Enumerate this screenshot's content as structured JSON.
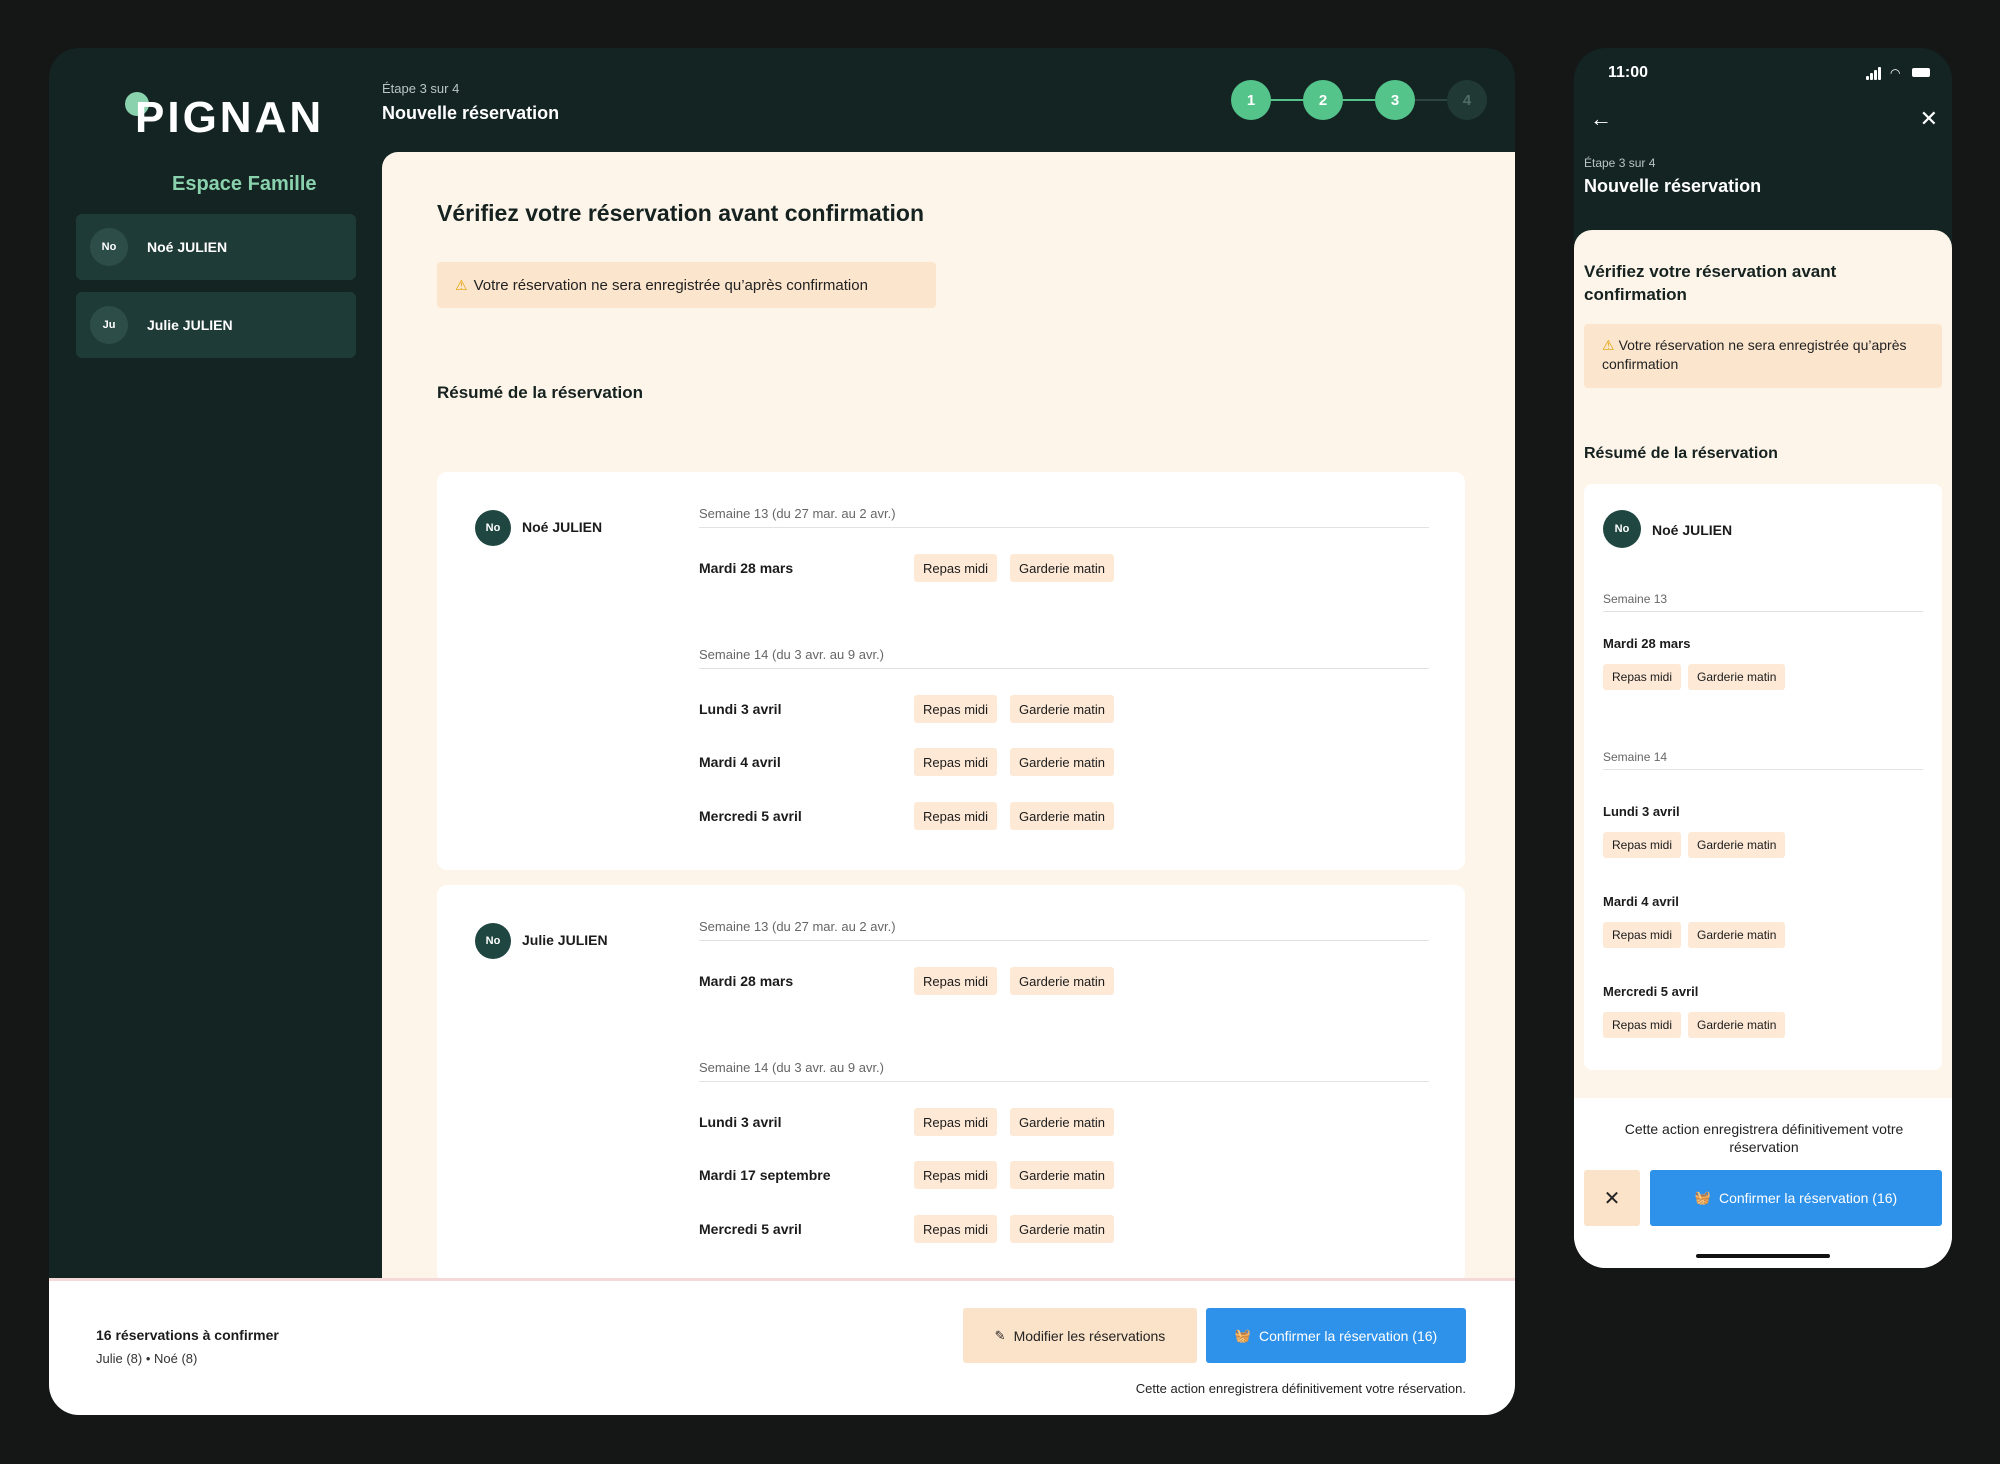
{
  "brand": {
    "name": "PIGNAN",
    "subtitle": "Espace Famille"
  },
  "sidebar": {
    "children": [
      {
        "initials": "No",
        "name": "Noé JULIEN"
      },
      {
        "initials": "Ju",
        "name": "Julie JULIEN"
      }
    ]
  },
  "header": {
    "step_text": "Étape 3 sur 4",
    "title": "Nouvelle réservation"
  },
  "stepper": {
    "steps": [
      "1",
      "2",
      "3",
      "4"
    ],
    "current": 3
  },
  "main": {
    "heading": "Vérifiez votre réservation avant confirmation",
    "warning_icon": "⚠",
    "warning": "Votre réservation ne sera enregistrée qu’après confirmation",
    "summary_title": "Résumé de la réservation",
    "cards": [
      {
        "initials": "No",
        "name": "Noé JULIEN",
        "weeks": [
          {
            "label": "Semaine 13 (du 27 mar. au 2 avr.)",
            "days": [
              {
                "date": "Mardi 28 mars",
                "tags": [
                  "Repas midi",
                  "Garderie matin"
                ]
              }
            ]
          },
          {
            "label": "Semaine 14 (du 3 avr. au 9 avr.)",
            "days": [
              {
                "date": "Lundi 3 avril",
                "tags": [
                  "Repas midi",
                  "Garderie matin"
                ]
              },
              {
                "date": "Mardi 4 avril",
                "tags": [
                  "Repas midi",
                  "Garderie matin"
                ]
              },
              {
                "date": "Mercredi 5 avril",
                "tags": [
                  "Repas midi",
                  "Garderie matin"
                ]
              }
            ]
          }
        ]
      },
      {
        "initials": "No",
        "name": "Julie JULIEN",
        "weeks": [
          {
            "label": "Semaine 13 (du 27 mar. au 2 avr.)",
            "days": [
              {
                "date": "Mardi 28 mars",
                "tags": [
                  "Repas midi",
                  "Garderie matin"
                ]
              }
            ]
          },
          {
            "label": "Semaine 14 (du 3 avr. au 9 avr.)",
            "days": [
              {
                "date": "Lundi 3 avril",
                "tags": [
                  "Repas midi",
                  "Garderie matin"
                ]
              },
              {
                "date": "Mardi 17 septembre",
                "tags": [
                  "Repas midi",
                  "Garderie matin"
                ]
              },
              {
                "date": "Mercredi 5 avril",
                "tags": [
                  "Repas midi",
                  "Garderie matin"
                ]
              }
            ]
          }
        ]
      }
    ]
  },
  "footer": {
    "count": "16 réservations à confirmer",
    "breakdown": "Julie (8) • Noé (8)",
    "modify_label": "Modifier les réservations",
    "confirm_label": "Confirmer la réservation (16)",
    "note": "Cette action enregistrera définitivement votre réservation."
  },
  "mobile": {
    "time": "11:00",
    "step_text": "Étape 3 sur 4",
    "title": "Nouvelle réservation",
    "heading": "Vérifiez votre réservation avant confirmation",
    "warning": "Votre réservation ne sera enregistrée qu’après confirmation",
    "summary_title": "Résumé de la réservation",
    "card": {
      "initials": "No",
      "name": "Noé JULIEN",
      "week1": "Semaine 13",
      "week2": "Semaine 14",
      "days": [
        {
          "date": "Mardi 28 mars",
          "tags": [
            "Repas midi",
            "Garderie matin"
          ]
        },
        {
          "date": "Lundi 3 avril",
          "tags": [
            "Repas midi",
            "Garderie matin"
          ]
        },
        {
          "date": "Mardi 4 avril",
          "tags": [
            "Repas midi",
            "Garderie matin"
          ]
        },
        {
          "date": "Mercredi 5 avril",
          "tags": [
            "Repas midi",
            "Garderie matin"
          ]
        }
      ]
    },
    "note": "Cette action enregistrera définitivement votre réservation",
    "close_glyph": "✕",
    "confirm_label": "Confirmer la réservation (16)"
  },
  "colors": {
    "dark_green": "#132422",
    "accent_green": "#54c48b",
    "cream": "#fef5ea",
    "tag": "#fde9d6",
    "primary_blue": "#2e92ea"
  }
}
